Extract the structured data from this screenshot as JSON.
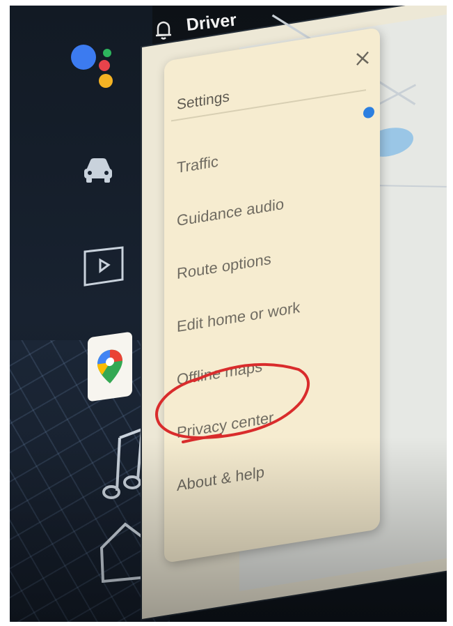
{
  "header": {
    "title": "Driver"
  },
  "settings_panel": {
    "title": "Settings",
    "items": [
      {
        "label": "Traffic"
      },
      {
        "label": "Guidance audio"
      },
      {
        "label": "Route options"
      },
      {
        "label": "Edit home or work"
      },
      {
        "label": "Offline maps"
      },
      {
        "label": "Privacy center"
      },
      {
        "label": "About & help"
      }
    ]
  },
  "sidebar": {
    "icons": [
      "google-assistant-icon",
      "car-icon",
      "media-play-icon",
      "google-maps-icon",
      "music-note-icon",
      "home-icon"
    ]
  },
  "colors": {
    "panel_bg": "#f6ecd0",
    "toggle_accent": "#2c7fe0",
    "annotation_red": "#d92c2c",
    "sidebar_bg": "#121a24"
  },
  "annotation": {
    "highlighted_item": "Offline maps"
  }
}
